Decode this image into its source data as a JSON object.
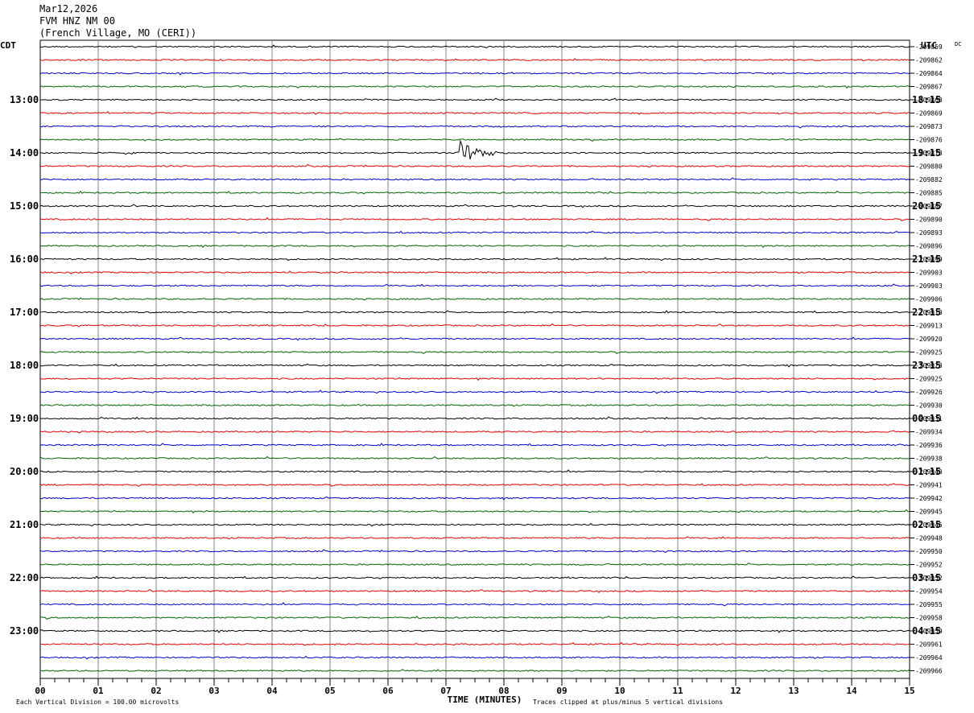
{
  "header": {
    "date": "Mar12,2026",
    "station": "FVM HNZ NM 00",
    "location": "(French Village, MO (CERI))"
  },
  "chart_data": {
    "type": "line",
    "left_zone": "CDT",
    "right_zone": "UTC",
    "right_header": "DC",
    "xlabel": "TIME (MINUTES)",
    "x_ticks": [
      "00",
      "01",
      "02",
      "03",
      "04",
      "05",
      "06",
      "07",
      "08",
      "09",
      "10",
      "11",
      "12",
      "13",
      "14",
      "15"
    ],
    "xlim": [
      0,
      15
    ],
    "left_hour_labels": [
      "13:00",
      "14:00",
      "15:00",
      "16:00",
      "17:00",
      "18:00",
      "19:00",
      "20:00",
      "21:00",
      "22:00",
      "23:00"
    ],
    "right_hour_labels": [
      "18:15",
      "19:15",
      "20:15",
      "21:15",
      "22:15",
      "23:15",
      "00:15",
      "01:15",
      "02:15",
      "03:15",
      "04:15"
    ],
    "trace_colors": [
      "#000000",
      "#e00000",
      "#0000cc",
      "#006400"
    ],
    "dc_offsets": [
      "-209859",
      "-209862",
      "-209864",
      "-209867",
      "-209868",
      "-209869",
      "-209873",
      "-209876",
      "-209878",
      "-209880",
      "-209882",
      "-209885",
      "-209887",
      "-209890",
      "-209893",
      "-209896",
      "-209899",
      "-209903",
      "-209903",
      "-209906",
      "-209910",
      "-209913",
      "-209920",
      "-209925",
      "-209923",
      "-209925",
      "-209926",
      "-209930",
      "-209931",
      "-209934",
      "-209936",
      "-209938",
      "-209940",
      "-209941",
      "-209942",
      "-209945",
      "-209945",
      "-209948",
      "-209950",
      "-209952",
      "-209952",
      "-209954",
      "-209955",
      "-209958",
      "-209959",
      "-209961",
      "-209964",
      "-209966"
    ],
    "event": {
      "trace": 8,
      "start_minute": 7.2,
      "peak_amplitude_divisions": 1.2,
      "decay_minutes": 0.9
    }
  },
  "footer": {
    "scale_note": "Each Vertical Division =  100.00 microvolts",
    "clip_note": "Traces clipped at plus/minus 5 vertical divisions"
  }
}
